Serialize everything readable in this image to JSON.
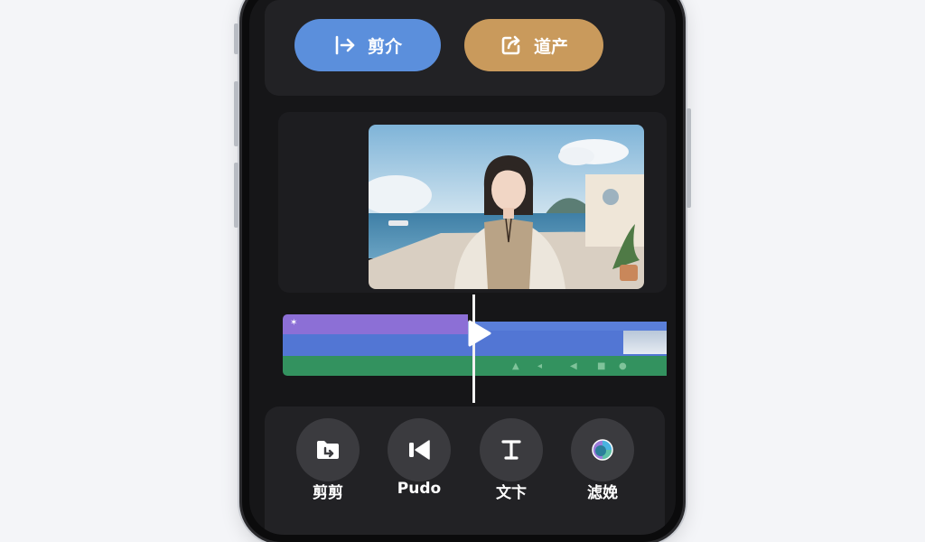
{
  "header": {
    "cut_button_label": "剪介",
    "export_button_label": "道产"
  },
  "preview": {
    "description_icon": "video-frame"
  },
  "timeline": {
    "clip_marker": "✶"
  },
  "toolbar": {
    "items": [
      {
        "label": "剪剪",
        "icon": "folder-import-icon"
      },
      {
        "label": "Pudo",
        "icon": "audio-icon"
      },
      {
        "label": "文卞",
        "icon": "text-icon"
      },
      {
        "label": "滤娩",
        "icon": "filter-icon"
      }
    ]
  },
  "colors": {
    "cut_button": "#5b8fdc",
    "export_button": "#c99a5c",
    "track_purple": "#8c6fd6",
    "track_blue": "#5276d4",
    "track_green": "#33925f"
  }
}
